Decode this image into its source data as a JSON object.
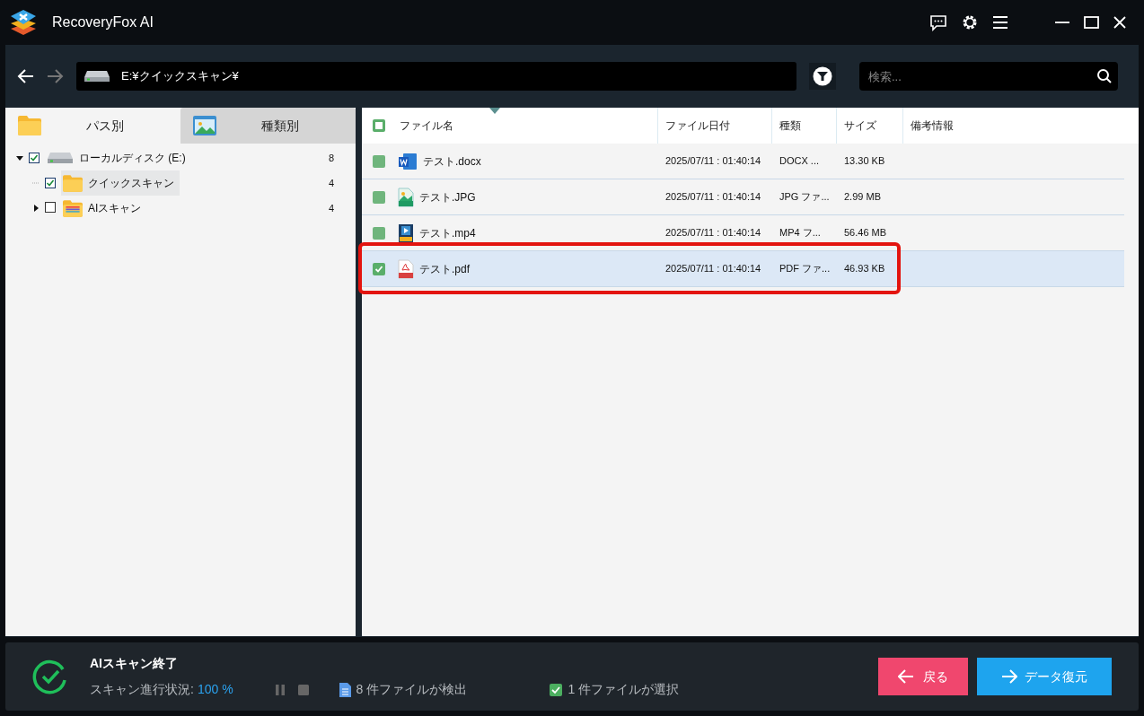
{
  "window": {
    "title": "RecoveryFox AI"
  },
  "path_field": {
    "value": "E:¥クイックスキャン¥"
  },
  "search": {
    "placeholder": "検索..."
  },
  "tabs": [
    {
      "label": "パス別",
      "kind": "folder",
      "selected": true
    },
    {
      "label": "種類別",
      "kind": "image",
      "selected": false
    }
  ],
  "tree": [
    {
      "label": "ローカルディスク (E:)",
      "kind": "drive",
      "count": "8",
      "checked": true,
      "expanded": true,
      "selected": false,
      "children": [
        {
          "label": "クイックスキャン",
          "kind": "folder",
          "count": "4",
          "checked": true,
          "expanded": false,
          "selected": true
        },
        {
          "label": "AIスキャン",
          "kind": "ai-folder",
          "count": "4",
          "checked": false,
          "expanded": false,
          "selected": false
        }
      ]
    }
  ],
  "table": {
    "all_checked": false,
    "columns": [
      "ファイル名",
      "ファイル日付",
      "種類",
      "サイズ",
      "備考情報"
    ],
    "rows": [
      {
        "kind": "word",
        "name": "テスト.docx",
        "date": "2025/07/11 : 01:40:14",
        "type": "DOCX ...",
        "size": "13.30 KB",
        "checked": false,
        "selected": false,
        "highlighted": false
      },
      {
        "kind": "image",
        "name": "テスト.JPG",
        "date": "2025/07/11 : 01:40:14",
        "type": "JPG ファ...",
        "size": "2.99 MB",
        "checked": false,
        "selected": false,
        "highlighted": false
      },
      {
        "kind": "video",
        "name": "テスト.mp4",
        "date": "2025/07/11 : 01:40:14",
        "type": "MP4 フ...",
        "size": "56.46 MB",
        "checked": false,
        "selected": false,
        "highlighted": false
      },
      {
        "kind": "pdf",
        "name": "テスト.pdf",
        "date": "2025/07/11 : 01:40:14",
        "type": "PDF ファ...",
        "size": "46.93 KB",
        "checked": true,
        "selected": true,
        "highlighted": true
      }
    ]
  },
  "status": {
    "title": "AIスキャン終了",
    "progress_label": "スキャン進行状況:",
    "progress_value": "100 %",
    "found_count": "8",
    "found_label": "件ファイルが検出",
    "selected_count": "1",
    "selected_label": "件ファイルが選択"
  },
  "buttons": {
    "back": "戻る",
    "recover": "データ復元"
  }
}
